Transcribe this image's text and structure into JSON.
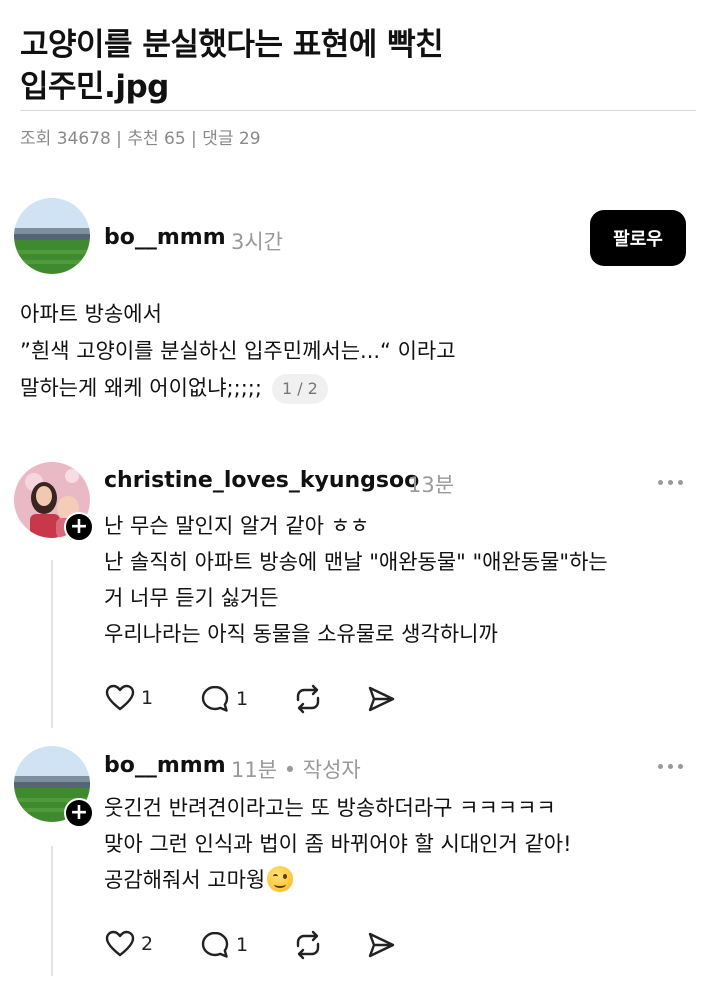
{
  "post": {
    "title_line1": "고양이를 분실했다는 표현에 빡친",
    "title_line2": "입주민.jpg",
    "stats": {
      "views_label": "조회",
      "views": "34678",
      "recommend_label": "추천",
      "recommend": "65",
      "comments_label": "댓글",
      "comments": "29"
    }
  },
  "thread": {
    "author": "bo__mmm",
    "time": "3시간",
    "follow_label": "팔로우",
    "body": [
      "아파트 방송에서",
      "”흰색 고양이를 분실하신 입주민께서는...“ 이라고",
      "말하는게 왜케 어이없냐;;;;;"
    ],
    "page_indicator": "1 / 2"
  },
  "replies": [
    {
      "author": "christine_loves_kyungsoo",
      "time": "13분",
      "body": [
        "난 무슨 말인지 알거 같아 ㅎㅎ",
        "난 솔직히 아파트 방송에 맨날 \"애완동물\" \"애완동물\"하는",
        "거 너무 듣기 싫거든",
        "우리나라는 아직 동물을 소유물로 생각하니까"
      ],
      "likes": "1",
      "replies": "1"
    },
    {
      "author": "bo__mmm",
      "time": "11분 • 작성자",
      "body": [
        "웃긴건 반려견이라고는 또 방송하더라구 ㅋㅋㅋㅋㅋ",
        "맞아 그런 인식과 법이 좀 바뀌어야 할 시대인거 같아!",
        "공감해줘서 고마웡"
      ],
      "likes": "2",
      "replies": "1"
    }
  ],
  "icons": {
    "like": "heart-icon",
    "reply": "comment-bubble-icon",
    "repost": "repost-icon",
    "share": "send-icon",
    "more": "more-dots-icon",
    "follow_plus": "plus-icon",
    "emoji": "smiling-face-emoji"
  }
}
